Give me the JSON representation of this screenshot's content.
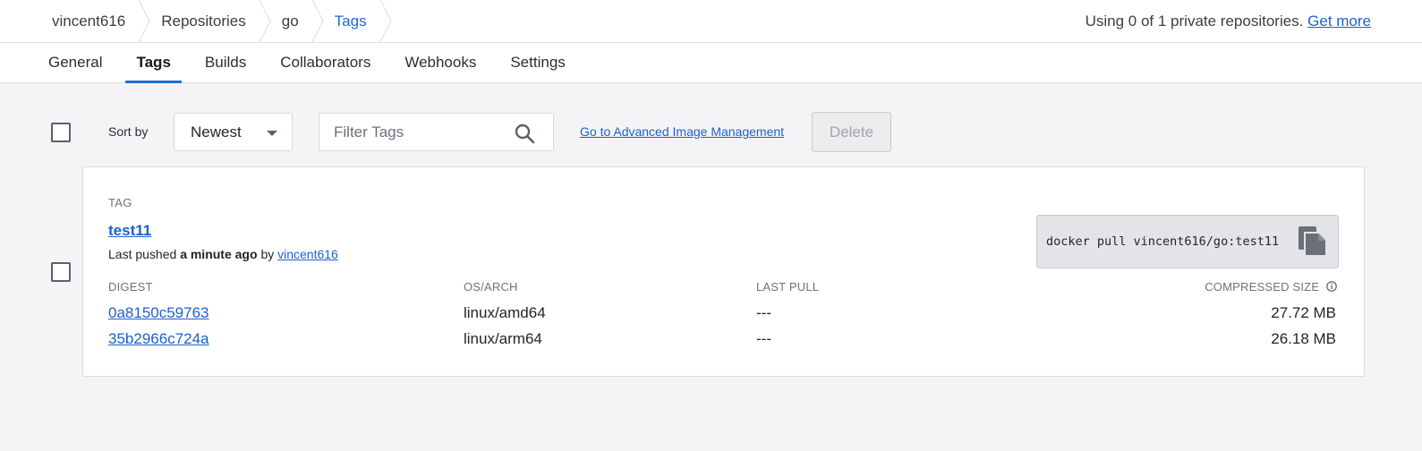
{
  "breadcrumb": [
    {
      "label": "vincent616"
    },
    {
      "label": "Repositories"
    },
    {
      "label": "go"
    },
    {
      "label": "Tags"
    }
  ],
  "quota": {
    "text": "Using 0 of 1 private repositories.",
    "link": "Get more"
  },
  "tabs": [
    {
      "label": "General"
    },
    {
      "label": "Tags"
    },
    {
      "label": "Builds"
    },
    {
      "label": "Collaborators"
    },
    {
      "label": "Webhooks"
    },
    {
      "label": "Settings"
    }
  ],
  "active_tab": "Tags",
  "toolbar": {
    "sort_label": "Sort by",
    "sort_value": "Newest",
    "filter_placeholder": "Filter Tags",
    "advanced_link": "Go to Advanced Image Management",
    "delete_label": "Delete"
  },
  "tag": {
    "section_label": "TAG",
    "name": "test11",
    "pushed_prefix": "Last pushed",
    "pushed_when": "a minute ago",
    "pushed_by_word": "by",
    "pushed_by": "vincent616",
    "pull_command": "docker pull vincent616/go:test11",
    "columns": {
      "digest": "DIGEST",
      "os_arch": "OS/ARCH",
      "last_pull": "LAST PULL",
      "compressed_size": "COMPRESSED SIZE"
    },
    "rows": [
      {
        "digest": "0a8150c59763",
        "os_arch": "linux/amd64",
        "last_pull": "---",
        "size": "27.72 MB"
      },
      {
        "digest": "35b2966c724a",
        "os_arch": "linux/arm64",
        "last_pull": "---",
        "size": "26.18 MB"
      }
    ]
  },
  "colors": {
    "accent": "#1f6fd6",
    "link": "#1c62c8"
  }
}
